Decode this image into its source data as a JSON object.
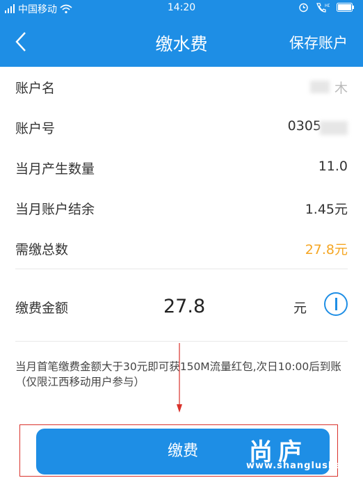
{
  "status_bar": {
    "carrier": "中国移动",
    "time": "14:20"
  },
  "nav": {
    "title": "缴水费",
    "action_label": "保存账户"
  },
  "account": {
    "rows": [
      {
        "label": "账户名",
        "value": "木"
      },
      {
        "label": "账户号",
        "value": "0305"
      },
      {
        "label": "当月产生数量",
        "value": "11.0"
      },
      {
        "label": "当月账户结余",
        "value": "1.45元"
      },
      {
        "label": "需缴总数",
        "value": "27.8元"
      }
    ]
  },
  "payment": {
    "label": "缴费金额",
    "amount": "27.8",
    "unit": "元"
  },
  "notice": "当月首笔缴费金额大于30元即可获150M流量红包,次日10:00后到账（仅限江西移动用户参与）",
  "pay_button_label": "缴费",
  "watermark": {
    "text": "尚庐",
    "url": "www.shanglushan"
  },
  "colors": {
    "primary": "#1e8ee5",
    "due_amount": "#f5a623",
    "annotation": "#d9322b"
  }
}
